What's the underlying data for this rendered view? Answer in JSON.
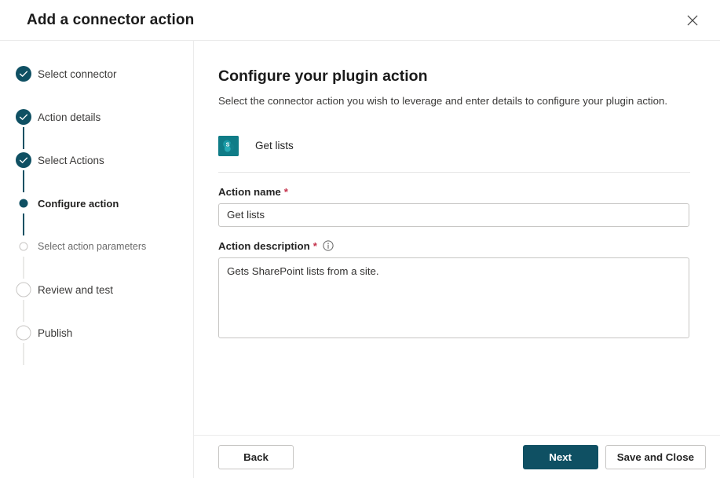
{
  "dialog": {
    "title": "Add a connector action",
    "close_icon": "close-icon"
  },
  "wizard": {
    "steps": [
      {
        "label": "Select connector",
        "state": "done"
      },
      {
        "label": "Action details",
        "state": "done"
      },
      {
        "label": "Select Actions",
        "state": "done"
      },
      {
        "label": "Configure action",
        "state": "current"
      },
      {
        "label": "Select action parameters",
        "state": "upcoming-small"
      },
      {
        "label": "Review and test",
        "state": "upcoming"
      },
      {
        "label": "Publish",
        "state": "upcoming"
      }
    ]
  },
  "main": {
    "heading": "Configure your plugin action",
    "subheading": "Select the connector action you wish to leverage and enter details to configure your plugin action.",
    "connector": {
      "icon": "sharepoint-icon",
      "name": "Get lists"
    },
    "fields": {
      "action_name": {
        "label": "Action name",
        "required_mark": "*",
        "value": "Get lists",
        "placeholder": "Action name"
      },
      "action_description": {
        "label": "Action description",
        "required_mark": "*",
        "info_icon": "info-icon",
        "value": "Gets SharePoint lists from a site.",
        "placeholder": "Action description"
      }
    }
  },
  "footer": {
    "back_label": "Back",
    "next_label": "Next",
    "save_close_label": "Save and Close"
  },
  "colors": {
    "accent_teal": "#0f5063",
    "sharepoint_teal": "#0f7c87",
    "required_red": "#c4314b",
    "border_gray": "#c7c6c4",
    "divider": "#ebebeb"
  }
}
